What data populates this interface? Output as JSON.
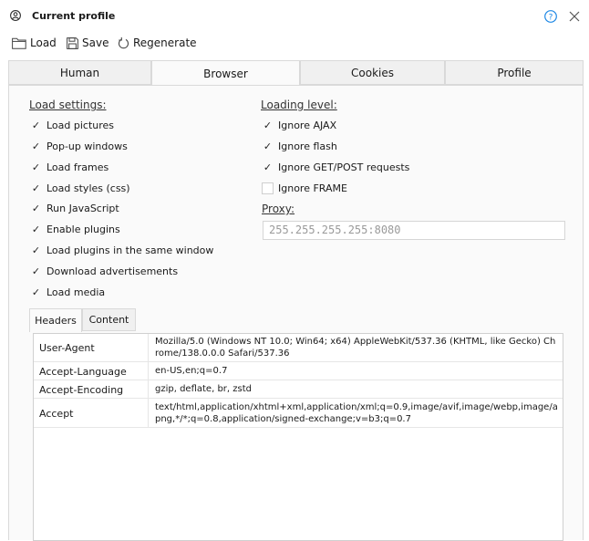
{
  "window": {
    "title": "Current profile",
    "icons": {
      "profile": "user-circle-icon",
      "help": "help-icon",
      "close": "close-icon"
    }
  },
  "toolbar": {
    "load_label": "Load",
    "save_label": "Save",
    "regenerate_label": "Regenerate",
    "icons": {
      "load": "folder-icon",
      "save": "floppy-icon",
      "regenerate": "refresh-icon"
    }
  },
  "tabs": [
    {
      "label": "Human",
      "active": false
    },
    {
      "label": "Browser",
      "active": true
    },
    {
      "label": "Cookies",
      "active": false
    },
    {
      "label": "Profile",
      "active": false
    }
  ],
  "load_settings": {
    "title": "Load settings:",
    "options": [
      {
        "label": "Load pictures",
        "checked": true
      },
      {
        "label": "Pop-up windows",
        "checked": true
      },
      {
        "label": "Load frames",
        "checked": true
      },
      {
        "label": "Load styles (css)",
        "checked": true
      },
      {
        "label": "Run JavaScript",
        "checked": true
      },
      {
        "label": "Enable plugins",
        "checked": true
      },
      {
        "label": "Load plugins in the same window",
        "checked": true
      },
      {
        "label": "Download advertisements",
        "checked": true
      },
      {
        "label": "Load media",
        "checked": true
      }
    ]
  },
  "loading_level": {
    "title": "Loading level:",
    "options": [
      {
        "label": "Ignore AJAX",
        "checked": true
      },
      {
        "label": "Ignore flash",
        "checked": true
      },
      {
        "label": "Ignore GET/POST requests",
        "checked": true
      },
      {
        "label": "Ignore FRAME",
        "checked": false
      }
    ]
  },
  "proxy": {
    "title": "Proxy:",
    "placeholder": "255.255.255.255:8080",
    "value": ""
  },
  "subtabs": [
    {
      "label": "Headers",
      "active": true
    },
    {
      "label": "Content",
      "active": false
    }
  ],
  "headers": [
    {
      "name": "User-Agent",
      "value": "Mozilla/5.0 (Windows NT 10.0; Win64; x64) AppleWebKit/537.36 (KHTML, like Gecko) Chrome/138.0.0.0 Safari/537.36"
    },
    {
      "name": "Accept-Language",
      "value": "en-US,en;q=0.7"
    },
    {
      "name": "Accept-Encoding",
      "value": "gzip, deflate, br, zstd"
    },
    {
      "name": "Accept",
      "value": "text/html,application/xhtml+xml,application/xml;q=0.9,image/avif,image/webp,image/apng,*/*;q=0.8,application/signed-exchange;v=b3;q=0.7"
    }
  ],
  "colors": {
    "accent": "#1e88e5",
    "panel_bg": "#fafafa",
    "tab_bg": "#f0f0f0",
    "border": "#d9d9d9"
  }
}
